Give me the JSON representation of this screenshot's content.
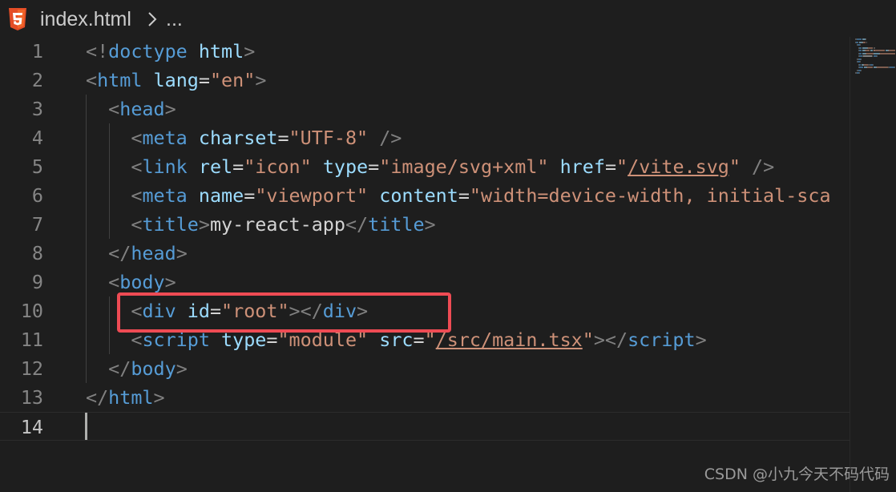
{
  "breadcrumb": {
    "file_name": "index.html",
    "more": "...",
    "file_icon": "html5-icon",
    "separator_icon": "chevron-right-icon"
  },
  "editor": {
    "active_line": 14,
    "line_numbers": [
      "1",
      "2",
      "3",
      "4",
      "5",
      "6",
      "7",
      "8",
      "9",
      "10",
      "11",
      "12",
      "13",
      "14"
    ],
    "lines": [
      [
        {
          "t": "<!",
          "c": "bracket"
        },
        {
          "t": "doctype",
          "c": "tag"
        },
        {
          "t": " ",
          "c": "text"
        },
        {
          "t": "html",
          "c": "attr"
        },
        {
          "t": ">",
          "c": "bracket"
        }
      ],
      [
        {
          "t": "<",
          "c": "bracket"
        },
        {
          "t": "html",
          "c": "tag"
        },
        {
          "t": " ",
          "c": "text"
        },
        {
          "t": "lang",
          "c": "attr"
        },
        {
          "t": "=",
          "c": "text"
        },
        {
          "t": "\"en\"",
          "c": "str"
        },
        {
          "t": ">",
          "c": "bracket"
        }
      ],
      [
        {
          "t": "  ",
          "c": "text"
        },
        {
          "t": "<",
          "c": "bracket"
        },
        {
          "t": "head",
          "c": "tag"
        },
        {
          "t": ">",
          "c": "bracket"
        }
      ],
      [
        {
          "t": "    ",
          "c": "text"
        },
        {
          "t": "<",
          "c": "bracket"
        },
        {
          "t": "meta",
          "c": "tag"
        },
        {
          "t": " ",
          "c": "text"
        },
        {
          "t": "charset",
          "c": "attr"
        },
        {
          "t": "=",
          "c": "text"
        },
        {
          "t": "\"UTF-8\"",
          "c": "str"
        },
        {
          "t": " />",
          "c": "bracket"
        }
      ],
      [
        {
          "t": "    ",
          "c": "text"
        },
        {
          "t": "<",
          "c": "bracket"
        },
        {
          "t": "link",
          "c": "tag"
        },
        {
          "t": " ",
          "c": "text"
        },
        {
          "t": "rel",
          "c": "attr"
        },
        {
          "t": "=",
          "c": "text"
        },
        {
          "t": "\"icon\"",
          "c": "str"
        },
        {
          "t": " ",
          "c": "text"
        },
        {
          "t": "type",
          "c": "attr"
        },
        {
          "t": "=",
          "c": "text"
        },
        {
          "t": "\"image/svg+xml\"",
          "c": "str"
        },
        {
          "t": " ",
          "c": "text"
        },
        {
          "t": "href",
          "c": "attr"
        },
        {
          "t": "=",
          "c": "text"
        },
        {
          "t": "\"",
          "c": "str"
        },
        {
          "t": "/vite.svg",
          "c": "str link"
        },
        {
          "t": "\"",
          "c": "str"
        },
        {
          "t": " />",
          "c": "bracket"
        }
      ],
      [
        {
          "t": "    ",
          "c": "text"
        },
        {
          "t": "<",
          "c": "bracket"
        },
        {
          "t": "meta",
          "c": "tag"
        },
        {
          "t": " ",
          "c": "text"
        },
        {
          "t": "name",
          "c": "attr"
        },
        {
          "t": "=",
          "c": "text"
        },
        {
          "t": "\"viewport\"",
          "c": "str"
        },
        {
          "t": " ",
          "c": "text"
        },
        {
          "t": "content",
          "c": "attr"
        },
        {
          "t": "=",
          "c": "text"
        },
        {
          "t": "\"width=device-width, initial-sca",
          "c": "str"
        }
      ],
      [
        {
          "t": "    ",
          "c": "text"
        },
        {
          "t": "<",
          "c": "bracket"
        },
        {
          "t": "title",
          "c": "tag"
        },
        {
          "t": ">",
          "c": "bracket"
        },
        {
          "t": "my-react-app",
          "c": "text"
        },
        {
          "t": "</",
          "c": "bracket"
        },
        {
          "t": "title",
          "c": "tag"
        },
        {
          "t": ">",
          "c": "bracket"
        }
      ],
      [
        {
          "t": "  ",
          "c": "text"
        },
        {
          "t": "</",
          "c": "bracket"
        },
        {
          "t": "head",
          "c": "tag"
        },
        {
          "t": ">",
          "c": "bracket"
        }
      ],
      [
        {
          "t": "  ",
          "c": "text"
        },
        {
          "t": "<",
          "c": "bracket"
        },
        {
          "t": "body",
          "c": "tag"
        },
        {
          "t": ">",
          "c": "bracket"
        }
      ],
      [
        {
          "t": "    ",
          "c": "text"
        },
        {
          "t": "<",
          "c": "bracket"
        },
        {
          "t": "div",
          "c": "tag"
        },
        {
          "t": " ",
          "c": "text"
        },
        {
          "t": "id",
          "c": "attr"
        },
        {
          "t": "=",
          "c": "text"
        },
        {
          "t": "\"root\"",
          "c": "str"
        },
        {
          "t": "></",
          "c": "bracket"
        },
        {
          "t": "div",
          "c": "tag"
        },
        {
          "t": ">",
          "c": "bracket"
        }
      ],
      [
        {
          "t": "    ",
          "c": "text"
        },
        {
          "t": "<",
          "c": "bracket"
        },
        {
          "t": "script",
          "c": "tag"
        },
        {
          "t": " ",
          "c": "text"
        },
        {
          "t": "type",
          "c": "attr"
        },
        {
          "t": "=",
          "c": "text"
        },
        {
          "t": "\"module\"",
          "c": "str"
        },
        {
          "t": " ",
          "c": "text"
        },
        {
          "t": "src",
          "c": "attr"
        },
        {
          "t": "=",
          "c": "text"
        },
        {
          "t": "\"",
          "c": "str"
        },
        {
          "t": "/src/main.tsx",
          "c": "str link"
        },
        {
          "t": "\"",
          "c": "str"
        },
        {
          "t": "></",
          "c": "bracket"
        },
        {
          "t": "script",
          "c": "tag"
        },
        {
          "t": ">",
          "c": "bracket"
        }
      ],
      [
        {
          "t": "  ",
          "c": "text"
        },
        {
          "t": "</",
          "c": "bracket"
        },
        {
          "t": "body",
          "c": "tag"
        },
        {
          "t": ">",
          "c": "bracket"
        }
      ],
      [
        {
          "t": "</",
          "c": "bracket"
        },
        {
          "t": "html",
          "c": "tag"
        },
        {
          "t": ">",
          "c": "bracket"
        }
      ],
      []
    ]
  },
  "highlight": {
    "color": "#ee4b54"
  },
  "colors": {
    "background": "#1e1e1e",
    "tag": "#569cd6",
    "attribute": "#9cdcfe",
    "string": "#ce9178",
    "bracket": "#808080",
    "text": "#d4d4d4",
    "line_number": "#858585",
    "html5_icon": "#e44d26"
  },
  "watermark": {
    "text": "CSDN @小九今天不码代码"
  }
}
